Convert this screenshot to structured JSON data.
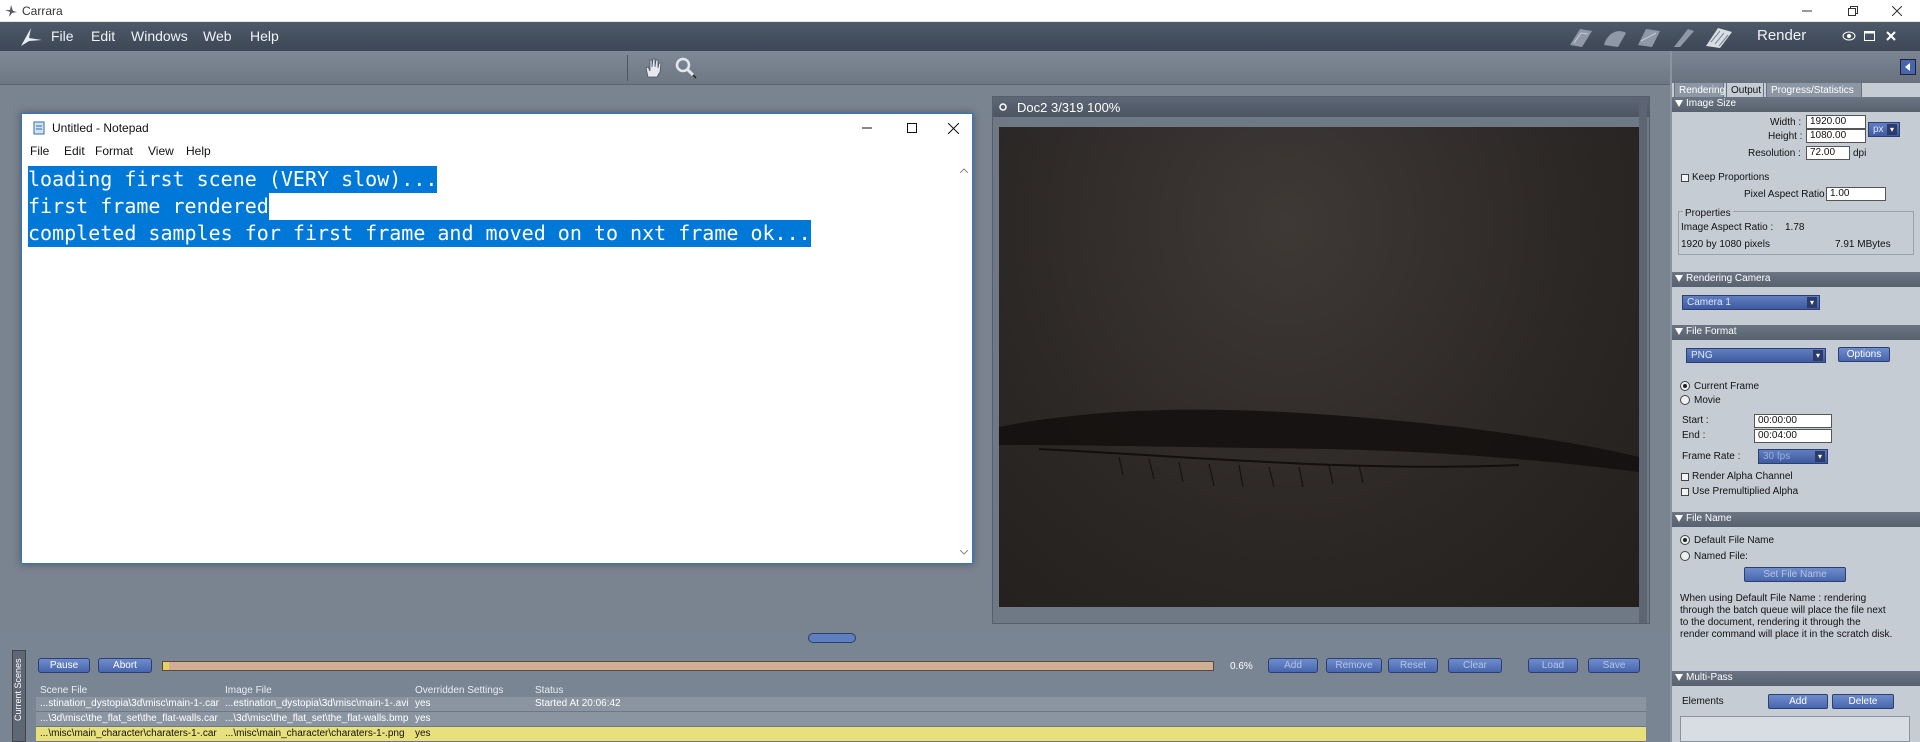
{
  "app": {
    "title": "Carrara"
  },
  "menubar": {
    "items": [
      "File",
      "Edit",
      "Windows",
      "Web",
      "Help"
    ],
    "room_label": "Render"
  },
  "notepad": {
    "title": "Untitled - Notepad",
    "menu": [
      "File",
      "Edit",
      "Format",
      "View",
      "Help"
    ],
    "lines": [
      "loading first scene (VERY slow)...",
      "first frame rendered",
      "completed samples for first frame and moved on to nxt frame ok..."
    ]
  },
  "doc": {
    "title": "Doc2 3/319 100%"
  },
  "panel": {
    "tabs": [
      "Rendering",
      "Output",
      "Progress/Statistics"
    ],
    "active_tab": "Output",
    "image_size": {
      "header": "Image Size",
      "width_label": "Width :",
      "width": "1920.00",
      "height_label": "Height :",
      "height": "1080.00",
      "unit": "px",
      "resolution_label": "Resolution :",
      "resolution": "72.00",
      "resolution_unit": "dpi",
      "keep_proportions": "Keep Proportions",
      "par_label": "Pixel Aspect Ratio :",
      "par": "1.00",
      "properties": "Properties",
      "aspect_label": "Image Aspect Ratio :",
      "aspect": "1.78",
      "pixels": "1920 by 1080 pixels",
      "mbytes": "7.91 MBytes"
    },
    "camera": {
      "header": "Rendering Camera",
      "value": "Camera 1"
    },
    "file_format": {
      "header": "File Format",
      "format": "PNG",
      "options_btn": "Options",
      "current_frame": "Current Frame",
      "movie": "Movie",
      "start_label": "Start :",
      "start": "00:00:00",
      "end_label": "End :",
      "end": "00:04:00",
      "frame_rate_label": "Frame Rate :",
      "frame_rate": "30 fps",
      "alpha": "Render Alpha Channel",
      "premult": "Use Premultiplied Alpha"
    },
    "file_name": {
      "header": "File Name",
      "default": "Default File Name",
      "named": "Named File:",
      "set_btn": "Set File Name",
      "note": [
        "When using Default File Name : rendering",
        "through the batch queue will place the file next",
        "to the document, rendering it through the",
        "render command will place it in the scratch disk."
      ]
    },
    "multipass": {
      "header": "Multi-Pass",
      "elements": "Elements",
      "add": "Add",
      "delete": "Delete"
    }
  },
  "queue": {
    "side_label": "Current Scenes",
    "pause": "Pause",
    "abort": "Abort",
    "progress": 0.006,
    "progress_text": "0.6%",
    "buttons": [
      "Add",
      "Remove",
      "Reset",
      "Clear",
      "Load",
      "Save"
    ],
    "columns": [
      "Scene File",
      "Image File",
      "Overridden Settings",
      "Status"
    ],
    "rows": [
      [
        "...stination_dystopia\\3d\\misc\\main-1-.car",
        "...estination_dystopia\\3d\\misc\\main-1-.avi",
        "yes",
        "Started At 20:06:42"
      ],
      [
        "...\\3d\\misc\\the_flat_set\\the_flat-walls.car",
        "...\\3d\\misc\\the_flat_set\\the_flat-walls.bmp",
        "yes",
        ""
      ],
      [
        "...\\misc\\main_character\\charaters-1-.car",
        "...\\misc\\main_character\\charaters-1-.png",
        "yes",
        ""
      ]
    ]
  },
  "colors": {
    "selection": "#0078d7",
    "queue_selected_row": "#e8e07a",
    "accent_button": "#4766ad"
  }
}
